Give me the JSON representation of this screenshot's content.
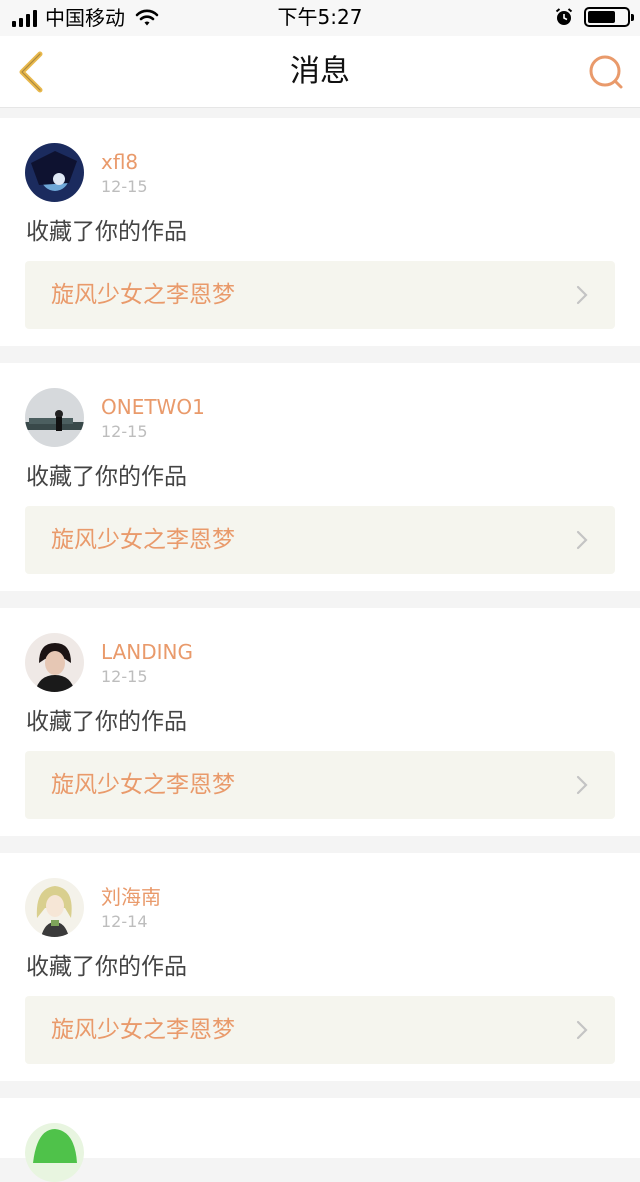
{
  "status_bar": {
    "carrier": "中国移动",
    "time": "下午5:27"
  },
  "nav": {
    "title": "消息",
    "back_icon": "chevron-left-icon",
    "search_icon": "search-icon"
  },
  "colors": {
    "accent": "#e99a6b",
    "back_icon": "#e8b84c",
    "link_bg": "#f5f5ee"
  },
  "messages": [
    {
      "username": "xfl8",
      "date": "12-15",
      "action": "收藏了你的作品",
      "work_title": "旋风少女之李恩梦"
    },
    {
      "username": "ONETWO1",
      "date": "12-15",
      "action": "收藏了你的作品",
      "work_title": "旋风少女之李恩梦"
    },
    {
      "username": "LANDING",
      "date": "12-15",
      "action": "收藏了你的作品",
      "work_title": "旋风少女之李恩梦"
    },
    {
      "username": "刘海南",
      "date": "12-14",
      "action": "收藏了你的作品",
      "work_title": "旋风少女之李恩梦"
    }
  ]
}
